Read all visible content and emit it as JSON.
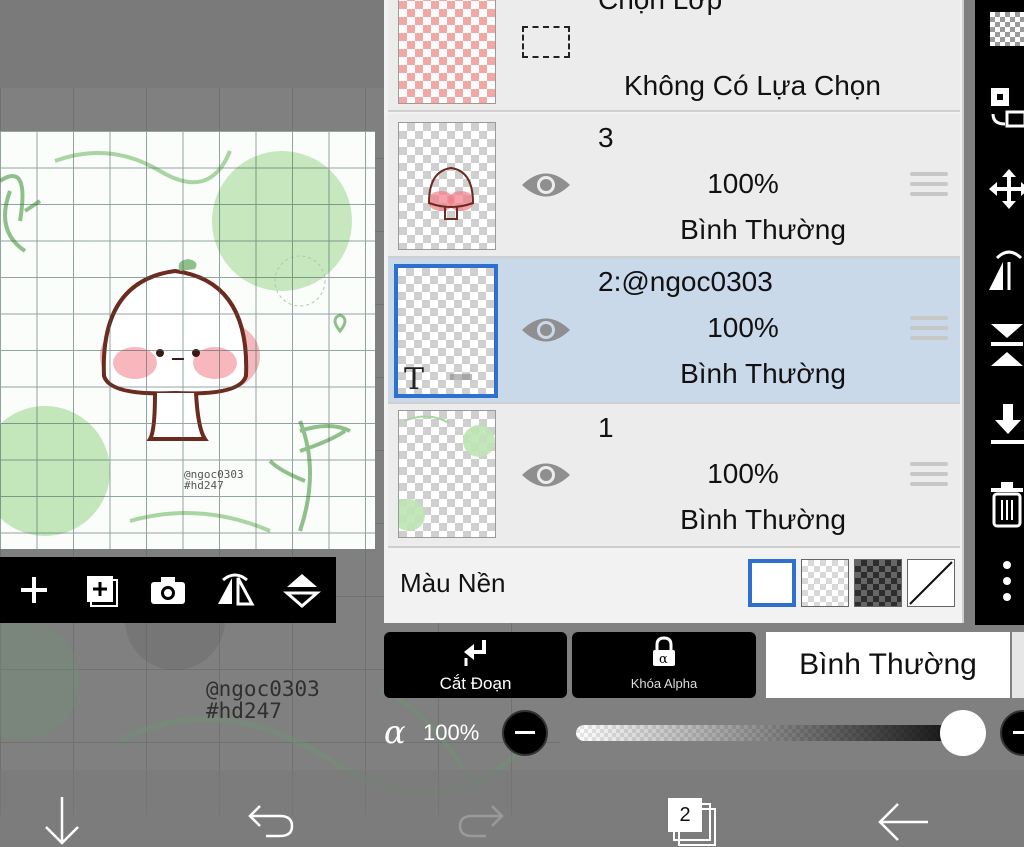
{
  "layers_panel": {
    "selection_row": {
      "title": "Chọn Lớp",
      "status": "Không Có Lựa Chọn"
    },
    "layers": [
      {
        "name": "3",
        "opacity": "100%",
        "blend_mode": "Bình Thường",
        "visible": true,
        "selected": false
      },
      {
        "name": "2:@ngoc0303",
        "opacity": "100%",
        "blend_mode": "Bình Thường",
        "visible": true,
        "selected": true,
        "thumb_glyph": "T"
      },
      {
        "name": "1",
        "opacity": "100%",
        "blend_mode": "Bình Thường",
        "visible": true,
        "selected": false
      }
    ],
    "background_label": "Màu Nền"
  },
  "controls": {
    "clip_label": "Cắt Đoạn",
    "alpha_lock_label": "Khóa Alpha",
    "blend_mode": "Bình Thường",
    "alpha_symbol": "α",
    "opacity_value": "100%",
    "opacity_fraction": 1.0
  },
  "artwork": {
    "watermark_small": [
      "@ngoc0303",
      "#hd247"
    ],
    "watermark_large": [
      "@ngoc0303",
      "#hd247"
    ]
  },
  "bottom_bar": {
    "layer_count": "2"
  },
  "icons": {
    "canvas_toolbar": [
      "add-layer-icon",
      "add-image-layer-icon",
      "camera-icon",
      "flip-horizontal-icon",
      "flip-vertical-icon"
    ],
    "right_toolbar": [
      "checker-icon",
      "transform-icon",
      "move-icon",
      "flip-h-icon",
      "merge-down-icon",
      "download-icon",
      "trash-icon",
      "more-icon"
    ],
    "bottom_bar": [
      "down-arrow-icon",
      "undo-icon",
      "redo-icon",
      "layers-icon",
      "back-icon"
    ]
  },
  "colors": {
    "selected_row": "#cad9ea",
    "selection_border": "#2f6fce",
    "toolbar": "#000000"
  }
}
